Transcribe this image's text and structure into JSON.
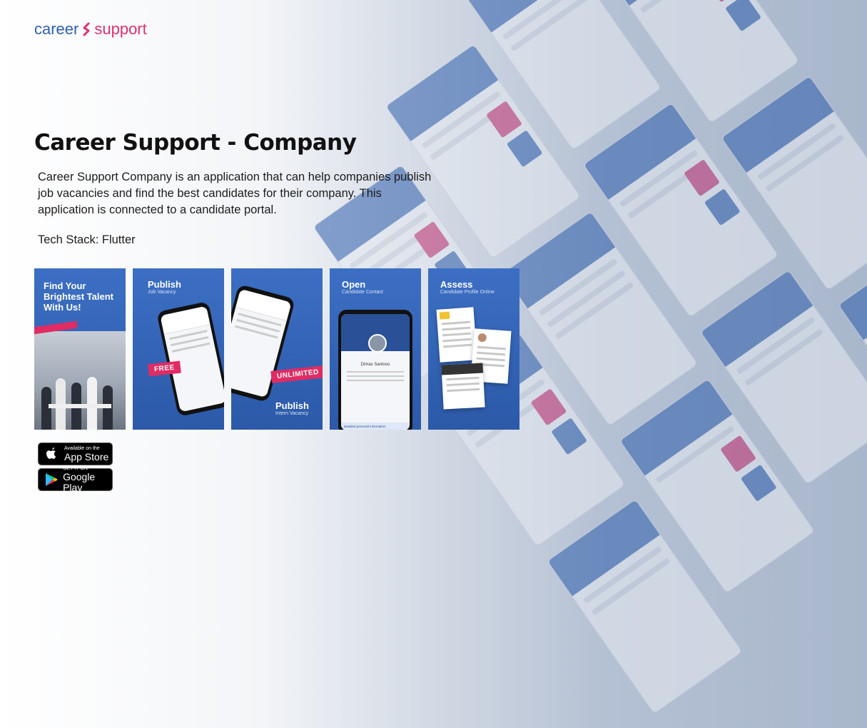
{
  "brand": {
    "logo_word1": "career",
    "logo_word2": "support",
    "accent": "#2e5fb0",
    "pink": "#e0306f"
  },
  "hero": {
    "title": "Career Support - Company",
    "description": "Career Support Company is an application that can help companies publish job vacancies and find the best candidates for their company. This application is connected to a candidate portal.",
    "tech_stack": "Tech Stack: Flutter"
  },
  "screenshots": [
    {
      "title_line1": "Find Your",
      "title_line2": "Brightest Talent",
      "title_line3": "With Us!"
    },
    {
      "title": "Publish",
      "subtitle": "Job Vacancy",
      "badge": "FREE"
    },
    {
      "title": "Publish",
      "subtitle": "Intern Vacancy",
      "badge": "UNLIMITED"
    },
    {
      "title": "Open",
      "subtitle": "Candidate Contact",
      "phone_name": "Dimas Santoso",
      "phone_footer": "Detailed personal information"
    },
    {
      "title": "Assess",
      "subtitle": "Candidate Profile Online"
    }
  ],
  "stores": {
    "appstore": {
      "line1": "Available on the",
      "line2": "App Store",
      "icon": "apple-icon"
    },
    "googleplay": {
      "line1": "GET IT ON",
      "line2": "Google Play",
      "icon": "google-play-icon"
    }
  }
}
